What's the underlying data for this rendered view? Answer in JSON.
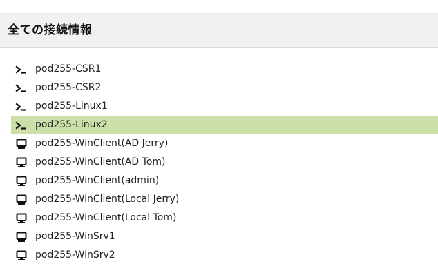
{
  "header": {
    "title": "全ての接続情報"
  },
  "connections": [
    {
      "label": "pod255-CSR1",
      "icon": "terminal-icon",
      "selected": false
    },
    {
      "label": "pod255-CSR2",
      "icon": "terminal-icon",
      "selected": false
    },
    {
      "label": "pod255-Linux1",
      "icon": "terminal-icon",
      "selected": false
    },
    {
      "label": "pod255-Linux2",
      "icon": "terminal-icon",
      "selected": true
    },
    {
      "label": "pod255-WinClient(AD Jerry)",
      "icon": "monitor-icon",
      "selected": false
    },
    {
      "label": "pod255-WinClient(AD Tom)",
      "icon": "monitor-icon",
      "selected": false
    },
    {
      "label": "pod255-WinClient(admin)",
      "icon": "monitor-icon",
      "selected": false
    },
    {
      "label": "pod255-WinClient(Local Jerry)",
      "icon": "monitor-icon",
      "selected": false
    },
    {
      "label": "pod255-WinClient(Local Tom)",
      "icon": "monitor-icon",
      "selected": false
    },
    {
      "label": "pod255-WinSrv1",
      "icon": "monitor-icon",
      "selected": false
    },
    {
      "label": "pod255-WinSrv2",
      "icon": "monitor-icon",
      "selected": false
    }
  ],
  "colors": {
    "selected_background": "#cddfa8",
    "header_background": "#f1f1f1"
  }
}
